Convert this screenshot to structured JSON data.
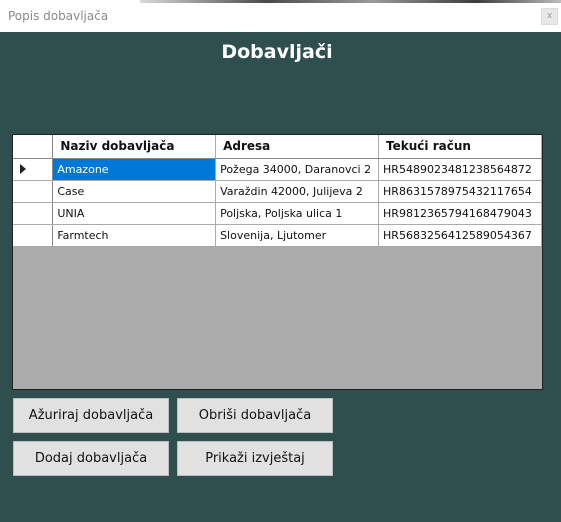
{
  "window": {
    "title": "Popis dobavljača",
    "close_label": "x"
  },
  "heading": "Dobavljači",
  "grid": {
    "columns": [
      "Naziv dobavljača",
      "Adresa",
      "Tekući račun"
    ],
    "rows": [
      {
        "naziv": "Amazone",
        "adresa": "Požega 34000, Daranovci 2",
        "racun": "HR5489023481238564872"
      },
      {
        "naziv": "Case",
        "adresa": "Varaždin 42000, Julijeva 2",
        "racun": "HR8631578975432117654"
      },
      {
        "naziv": "UNIA",
        "adresa": "Poljska, Poljska ulica 1",
        "racun": "HR9812365794168479043"
      },
      {
        "naziv": "Farmtech",
        "adresa": "Slovenija, Ljutomer",
        "racun": "HR5683256412589054367"
      }
    ]
  },
  "buttons": {
    "update": "Ažuriraj dobavljača",
    "delete": "Obriši dobavljača",
    "add": "Dodaj dobavljača",
    "report": "Prikaži izvještaj"
  }
}
